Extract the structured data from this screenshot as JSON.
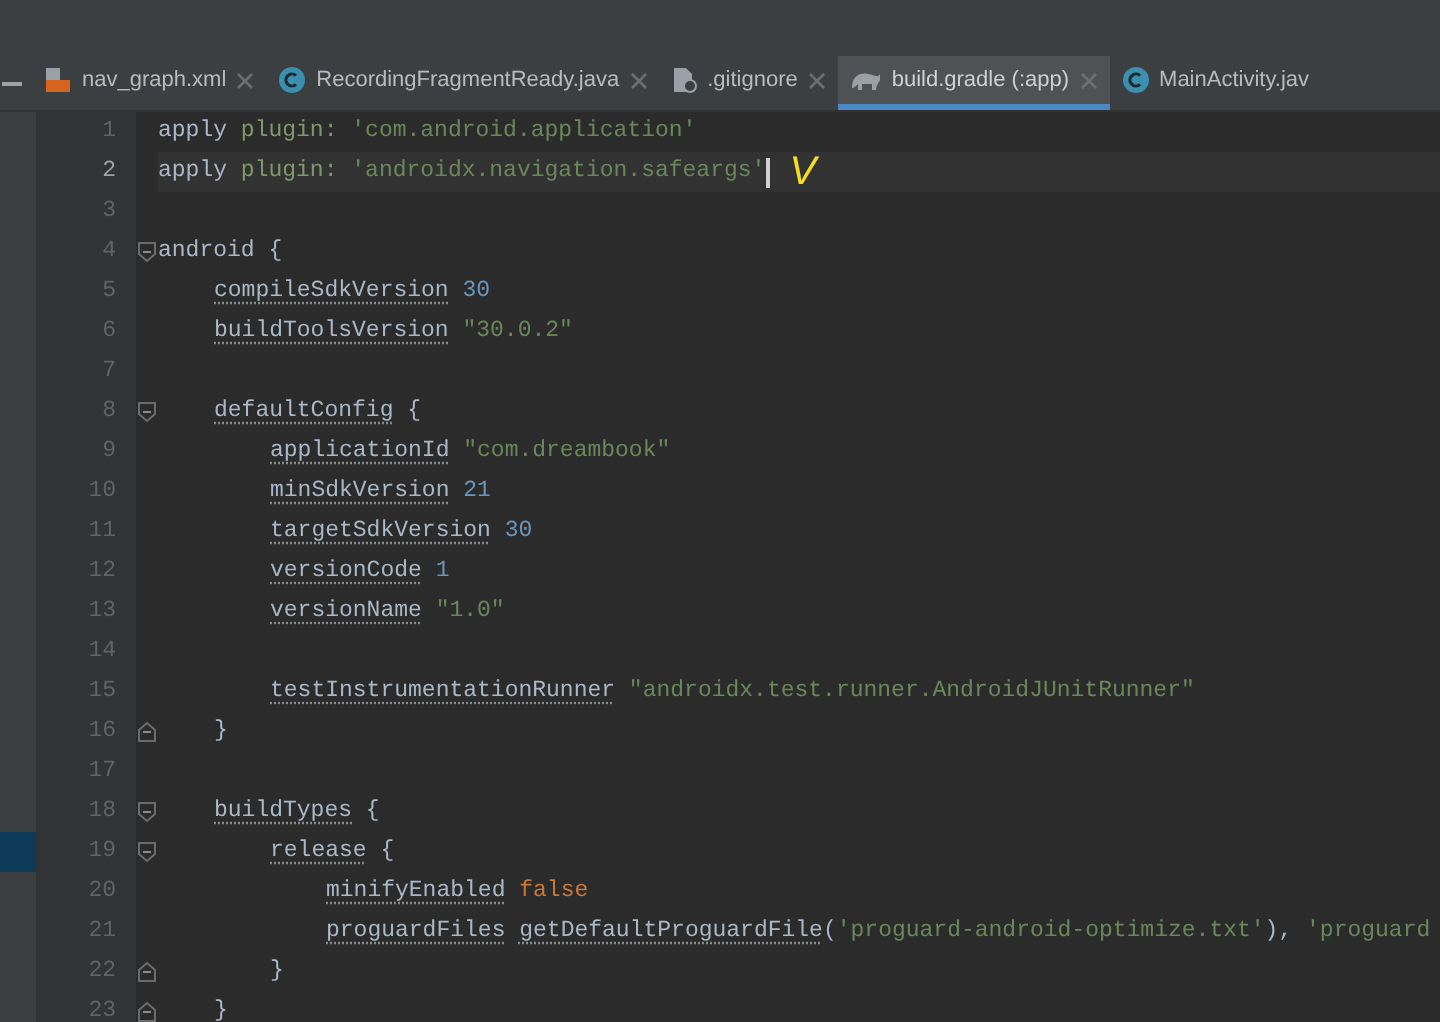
{
  "tabs": [
    {
      "label": "nav_graph.xml",
      "kind": "xml",
      "selected": false
    },
    {
      "label": "RecordingFragmentReady.java",
      "kind": "class",
      "selected": false
    },
    {
      "label": ".gitignore",
      "kind": "ignore",
      "selected": false
    },
    {
      "label": "build.gradle (:app)",
      "kind": "gradle",
      "selected": true
    },
    {
      "label": "MainActivity.jav",
      "kind": "class",
      "selected": false
    }
  ],
  "annotation": "V",
  "lines": [
    {
      "n": "1",
      "current": false,
      "marked": false,
      "tokens": [
        {
          "t": "apply ",
          "kind": "keyword"
        },
        {
          "t": "plugin: ",
          "kind": "named-arg"
        },
        {
          "t": "'com.android.application'",
          "kind": "string"
        }
      ]
    },
    {
      "n": "2",
      "current": true,
      "marked": false,
      "tokens": [
        {
          "t": "apply ",
          "kind": "keyword"
        },
        {
          "t": "plugin: ",
          "kind": "named-arg"
        },
        {
          "t": "'androidx.navigation.safeargs'",
          "kind": "string"
        }
      ]
    },
    {
      "n": "3",
      "current": false,
      "marked": false
    },
    {
      "n": "4",
      "kind": "open",
      "current": false,
      "marked": false,
      "tokens": [
        {
          "t": "android {",
          "kind": "plain"
        }
      ],
      "children": [
        {
          "n": "5",
          "current": false,
          "marked": false,
          "tokens": [
            {
              "t": "compileSdkVersion",
              "kind": "identifier"
            },
            {
              "t": " 30",
              "kind": "number"
            }
          ]
        },
        {
          "n": "6",
          "current": false,
          "marked": false,
          "tokens": [
            {
              "t": "buildToolsVersion",
              "kind": "identifier"
            },
            {
              "t": " \"30.0.2\"",
              "kind": "string"
            }
          ]
        },
        {
          "n": "7",
          "current": false,
          "marked": false
        },
        {
          "n": "8",
          "kind": "open",
          "current": false,
          "marked": false,
          "tokens": [
            {
              "t": "defaultConfig",
              "kind": "identifier"
            },
            {
              "t": " {",
              "kind": "plain"
            }
          ],
          "children": [
            {
              "n": "9",
              "current": false,
              "marked": false,
              "tokens": [
                {
                  "t": "applicationId",
                  "kind": "identifier"
                },
                {
                  "t": " \"com.dreambook\"",
                  "kind": "string"
                }
              ]
            },
            {
              "n": "10",
              "current": false,
              "marked": false,
              "tokens": [
                {
                  "t": "minSdkVersion",
                  "kind": "identifier"
                },
                {
                  "t": " 21",
                  "kind": "number"
                }
              ]
            },
            {
              "n": "11",
              "current": false,
              "marked": false,
              "tokens": [
                {
                  "t": "targetSdkVersion",
                  "kind": "identifier"
                },
                {
                  "t": " 30",
                  "kind": "number"
                }
              ]
            },
            {
              "n": "12",
              "current": false,
              "marked": false,
              "tokens": [
                {
                  "t": "versionCode",
                  "kind": "identifier"
                },
                {
                  "t": " 1",
                  "kind": "number"
                }
              ]
            },
            {
              "n": "13",
              "current": false,
              "marked": false,
              "tokens": [
                {
                  "t": "versionName",
                  "kind": "identifier"
                },
                {
                  "t": " \"1.0\"",
                  "kind": "string"
                }
              ]
            },
            {
              "n": "14",
              "current": false,
              "marked": false
            },
            {
              "n": "15",
              "current": false,
              "marked": false,
              "tokens": [
                {
                  "t": "testInstrumentationRunner",
                  "kind": "identifier"
                },
                {
                  "t": " \"androidx.test.runner.AndroidJUnitRunner\"",
                  "kind": "string"
                }
              ]
            }
          ]
        },
        {
          "n": "16",
          "kind": "close",
          "current": false,
          "marked": false,
          "tokens": [
            {
              "t": "}",
              "kind": "plain"
            }
          ]
        },
        {
          "n": "17",
          "current": false,
          "marked": false
        },
        {
          "n": "18",
          "kind": "open",
          "current": false,
          "marked": false,
          "tokens": [
            {
              "t": "buildTypes",
              "kind": "identifier"
            },
            {
              "t": " {",
              "kind": "plain"
            }
          ],
          "children": [
            {
              "n": "19",
              "kind": "open",
              "current": false,
              "marked": true,
              "tokens": [
                {
                  "t": "release",
                  "kind": "identifier"
                },
                {
                  "t": " {",
                  "kind": "plain"
                }
              ],
              "children": [
                {
                  "n": "20",
                  "current": false,
                  "marked": false,
                  "tokens": [
                    {
                      "t": "minifyEnabled",
                      "kind": "identifier"
                    },
                    {
                      "t": " false",
                      "kind": "literal"
                    }
                  ]
                },
                {
                  "n": "21",
                  "current": false,
                  "marked": false,
                  "tokens": [
                    {
                      "t": "proguardFiles ",
                      "kind": "identifier"
                    },
                    {
                      "t": "getDefaultProguardFile",
                      "kind": "identifier"
                    },
                    {
                      "t": "(",
                      "kind": "plain"
                    },
                    {
                      "t": "'proguard-android-optimize.txt'",
                      "kind": "string"
                    },
                    {
                      "t": "), ",
                      "kind": "plain"
                    },
                    {
                      "t": "'proguard",
                      "kind": "string"
                    }
                  ]
                }
              ]
            },
            {
              "n": "22",
              "kind": "close",
              "current": false,
              "marked": false,
              "tokens": [
                {
                  "t": "}",
                  "kind": "plain"
                }
              ]
            }
          ]
        },
        {
          "n": "23",
          "kind": "close",
          "current": false,
          "marked": false,
          "tokens": [
            {
              "t": "}",
              "kind": "plain"
            }
          ]
        }
      ]
    }
  ]
}
